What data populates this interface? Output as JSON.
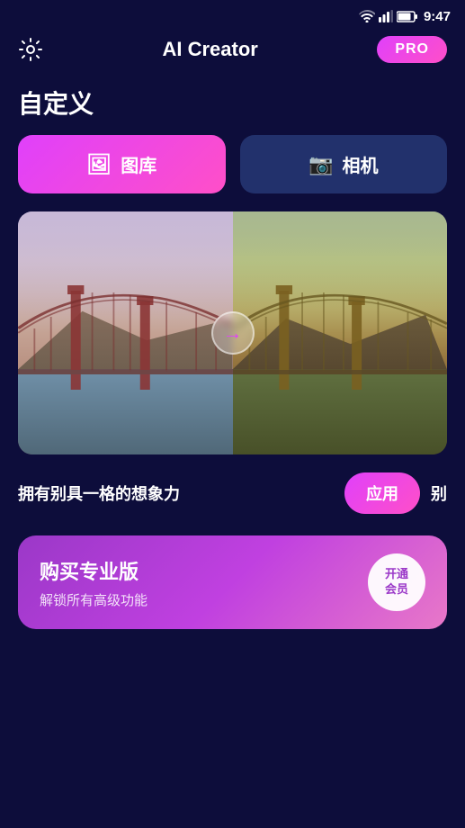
{
  "statusBar": {
    "time": "9:47"
  },
  "header": {
    "title": "AI Creator",
    "proBadge": "PRO",
    "settingsAriaLabel": "Settings"
  },
  "sectionTitle": "自定义",
  "buttons": {
    "gallery": "图库",
    "camera": "相机"
  },
  "imageCompare": {
    "arrowLabel": "→"
  },
  "bottomRow": {
    "label": "拥有别具一格的想象力",
    "applyBtn": "应用",
    "moreText": "别"
  },
  "proCard": {
    "title": "购买专业版",
    "subtitle": "解锁所有高级功能",
    "actionLine1": "开通",
    "actionLine2": "会员"
  }
}
